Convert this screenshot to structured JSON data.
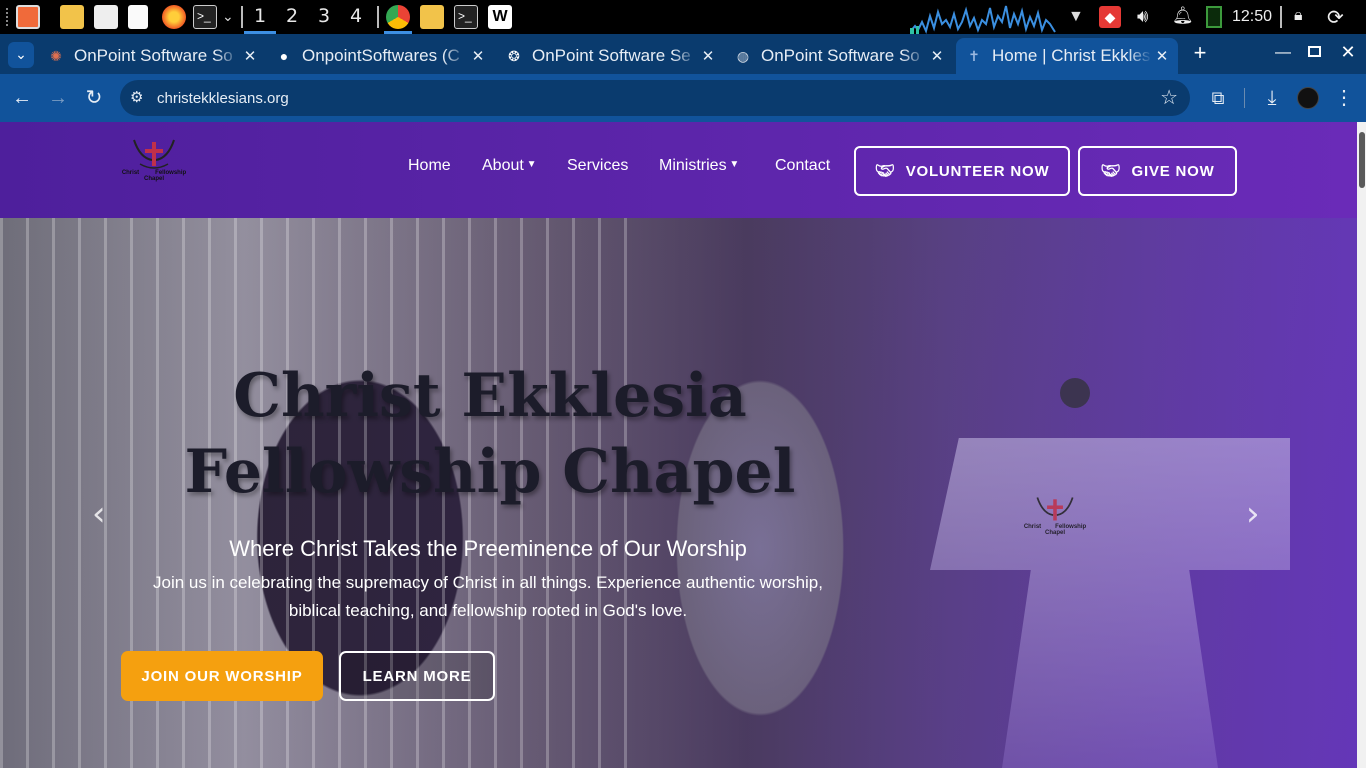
{
  "taskbar": {
    "workspaces": [
      "1",
      "2",
      "3",
      "4"
    ],
    "clock": "12:50"
  },
  "tabs": [
    {
      "title": "OnPoint Software So",
      "icon": "sparkle-icon"
    },
    {
      "title": "OnpointSoftwares (C",
      "icon": "github-icon"
    },
    {
      "title": "OnPoint Software Se",
      "icon": "openai-icon"
    },
    {
      "title": "OnPoint Software So",
      "icon": "globe-icon"
    },
    {
      "title": "Home | Christ Ekkles",
      "icon": "church-icon"
    }
  ],
  "address_bar": {
    "url": "christekklesians.org"
  },
  "site_nav": {
    "links": [
      "Home",
      "About",
      "Services",
      "Ministries",
      "Contact"
    ],
    "volunteer_label": "VOLUNTEER NOW",
    "give_label": "GIVE NOW",
    "logo_text": {
      "left": "Christ",
      "right": "Fellowship",
      "bottom": "Chapel"
    }
  },
  "hero": {
    "title_line1": "Christ Ekklesia",
    "title_line2": "Fellowship Chapel",
    "subtitle": "Where Christ Takes the Preeminence of Our Worship",
    "body_line1": "Join us in celebrating the supremacy of Christ in all things. Experience authentic worship,",
    "body_line2": "biblical teaching, and fellowship rooted in God's love.",
    "primary_cta": "JOIN OUR WORSHIP",
    "secondary_cta": "LEARN MORE"
  },
  "colors": {
    "nav_purple": "#5a26a8",
    "cta_orange": "#f5a00f",
    "tab_bar": "#0a3b6e",
    "toolbar": "#11539b"
  }
}
